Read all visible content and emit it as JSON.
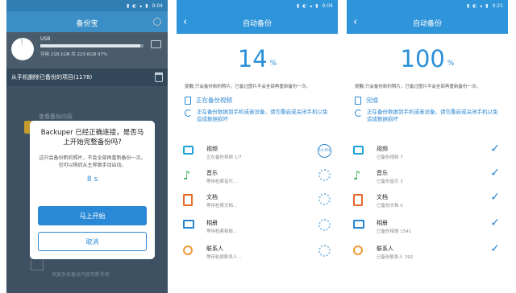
{
  "status_times": [
    "9:04",
    "9:04",
    "9:21"
  ],
  "phone1": {
    "title": "备份宝",
    "usb_name": "USB",
    "usb_used_fraction": 0.97,
    "usb_detail": "可用 218.1GB 共 223.6GB  97%",
    "deleted_label": "从手机删除已备份的项目(1178)",
    "behind_label": "查看备份内容",
    "restore_label": "恢复手机备份内容到新手机",
    "dialog": {
      "title": "Backuper 已经正确连接，是否马上开始完整备份吗?",
      "body": "这只会备份新的照片，不会全部再重新备份一次。也可以稍后从主界面手动启动。",
      "countdown": "8 s",
      "start_label": "马上开始",
      "cancel_label": "取消"
    }
  },
  "phone2": {
    "title": "自动备份",
    "percent": "14",
    "percent_sym": "%",
    "tip": "提醒:只会备份新的照片，已备过图片不会全部再重新备份一次。",
    "state": "正在备份视频",
    "sync_note": "正在备份数据到手机或者设备，请勿重启或关闭手机以免造成数据损坏",
    "items": [
      {
        "name": "视频",
        "detail": "正在备份视频 1/7",
        "progress": "14.0%"
      },
      {
        "name": "音乐",
        "detail": "等待检索音乐..."
      },
      {
        "name": "文档",
        "detail": "等待检索文档..."
      },
      {
        "name": "相册",
        "detail": "等待检索相册..."
      },
      {
        "name": "联系人",
        "detail": "等待检索联系人..."
      }
    ]
  },
  "phone3": {
    "title": "自动备份",
    "percent": "100",
    "percent_sym": "%",
    "tip": "提醒:只会备份新的照片，已备过图片不会全部再重新备份一次。",
    "state": "完成",
    "sync_note": "正在备份数据到手机或者设备，请勿重启或关闭手机以免造成数据损坏",
    "items": [
      {
        "name": "视频",
        "detail": "已备份视频  7"
      },
      {
        "name": "音乐",
        "detail": "已备份音乐  3"
      },
      {
        "name": "文档",
        "detail": "已备份文档  0"
      },
      {
        "name": "相册",
        "detail": "已备份相册  1541"
      },
      {
        "name": "联系人",
        "detail": "已备份联系人  292"
      }
    ]
  },
  "icons": {
    "back": "chevron-left-icon",
    "settings": "gear-icon",
    "folder": "folder-icon",
    "trash": "trash-icon",
    "video": "video-icon",
    "music": "music-note-icon",
    "doc": "document-icon",
    "album": "photo-icon",
    "contact": "person-icon",
    "done": "check-icon"
  },
  "colors": {
    "accent": "#2a86d1",
    "header": "#2e95da"
  }
}
